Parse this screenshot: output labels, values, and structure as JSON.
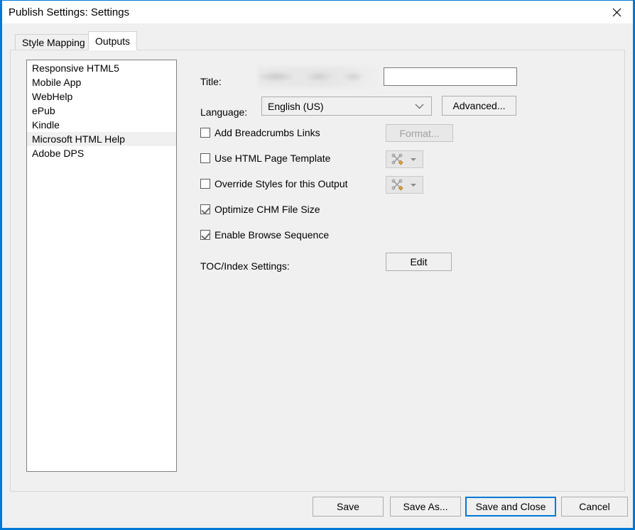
{
  "window": {
    "title": "Publish Settings: Settings",
    "close_icon": "close-icon",
    "accent_color": "#0078d7",
    "background_color": "#f0f0f0"
  },
  "tabs": [
    {
      "label": "Style Mapping",
      "active": false
    },
    {
      "label": "Outputs",
      "active": true
    }
  ],
  "output_list": {
    "items": [
      {
        "label": "Responsive HTML5",
        "selected": false
      },
      {
        "label": "Mobile App",
        "selected": false
      },
      {
        "label": "WebHelp",
        "selected": false
      },
      {
        "label": "ePub",
        "selected": false
      },
      {
        "label": "Kindle",
        "selected": false
      },
      {
        "label": "Microsoft HTML Help",
        "selected": true
      },
      {
        "label": "Adobe DPS",
        "selected": false
      }
    ]
  },
  "form": {
    "title_row": {
      "label": "Title:",
      "redacted": true,
      "input_value": "",
      "input_placeholder": ""
    },
    "language_row": {
      "label": "Language:",
      "selected": "English (US)",
      "chevron_icon": "chevron-down-icon",
      "advanced_button": "Advanced..."
    },
    "checkboxes": [
      {
        "label": "Add Breadcrumbs Links",
        "checked": false,
        "action": {
          "type": "button",
          "label": "Format...",
          "enabled": false
        }
      },
      {
        "label": "Use HTML Page Template",
        "checked": false,
        "action": {
          "type": "tools-dropdown",
          "icon": "tools-icon",
          "enabled": true
        }
      },
      {
        "label": "Override Styles for this Output",
        "checked": false,
        "action": {
          "type": "tools-dropdown",
          "icon": "tools-icon",
          "enabled": true
        }
      },
      {
        "label": "Optimize CHM File Size",
        "checked": true,
        "action": null
      },
      {
        "label": "Enable Browse Sequence",
        "checked": true,
        "action": null
      }
    ],
    "toc_row": {
      "label": "TOC/Index Settings:",
      "edit_button": "Edit"
    }
  },
  "footer": {
    "buttons": [
      {
        "label": "Save",
        "focused": false
      },
      {
        "label": "Save As...",
        "focused": false
      },
      {
        "label": "Save and Close",
        "focused": true
      },
      {
        "label": "Cancel",
        "focused": false
      }
    ]
  }
}
